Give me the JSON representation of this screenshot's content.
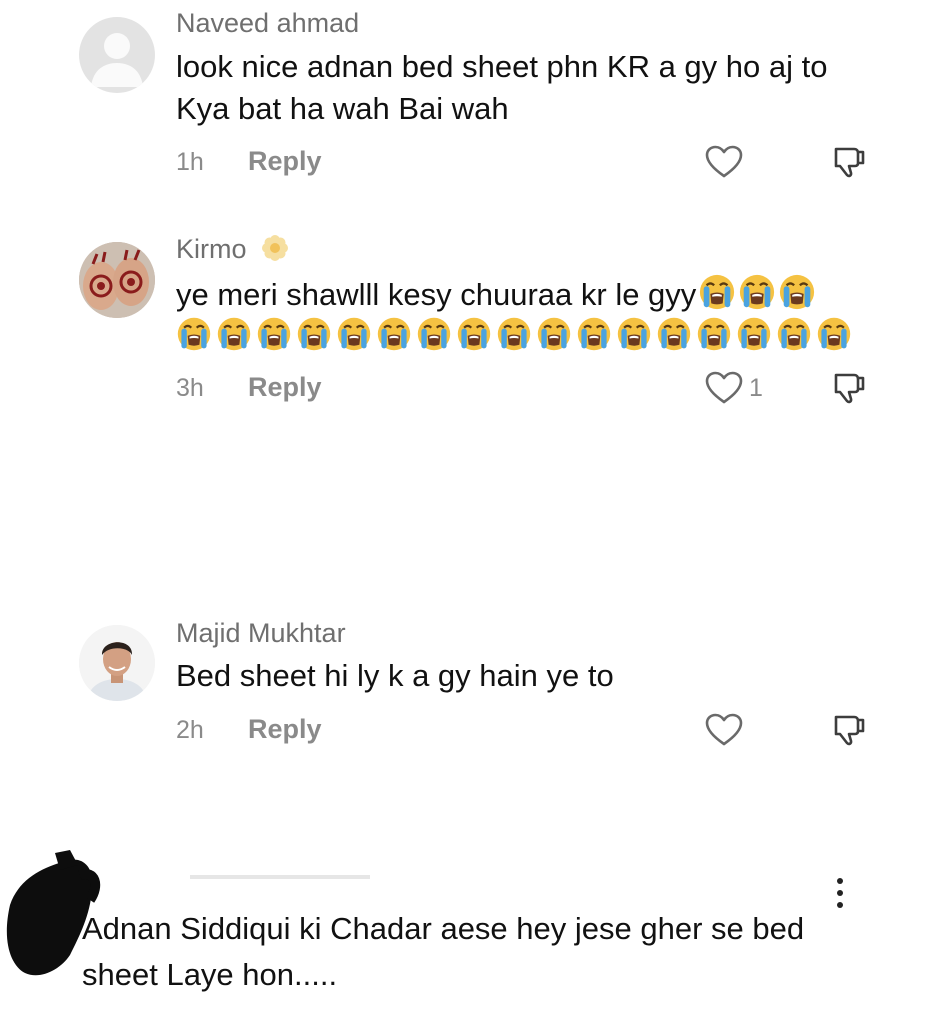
{
  "comments": [
    {
      "username": "Naveed ahmad",
      "text_line1": "look nice adnan bed sheet phn KR a gy ho aj to",
      "text_line2": "Kya bat ha wah Bai wah",
      "time": "1h",
      "reply_label": "Reply",
      "likes": ""
    },
    {
      "username": "Kirmo",
      "text_line1": "ye meri shawlll kesy chuuraa kr le gyy",
      "time": "3h",
      "reply_label": "Reply",
      "likes": "1"
    },
    {
      "username": "Majid Mukhtar",
      "text_line1": "Bed sheet hi ly k a gy hain ye to",
      "time": "2h",
      "reply_label": "Reply",
      "likes": ""
    },
    {
      "text_line1": "Adnan Siddiqui ki Chadar aese hey jese gher se bed",
      "text_line2": "sheet Laye hon....."
    }
  ],
  "icons": {
    "like": "heart-outline-icon",
    "dislike": "thumbs-down-icon",
    "emoji": "loudly-crying-face-emoji",
    "badge": "flower-badge-icon",
    "more": "more-vertical-icon"
  },
  "colors": {
    "username": "#6f6f6f",
    "meta": "#8a8a8a",
    "text": "#111111",
    "emoji_face": "#f5c242",
    "emoji_tears": "#4aa3e0"
  }
}
